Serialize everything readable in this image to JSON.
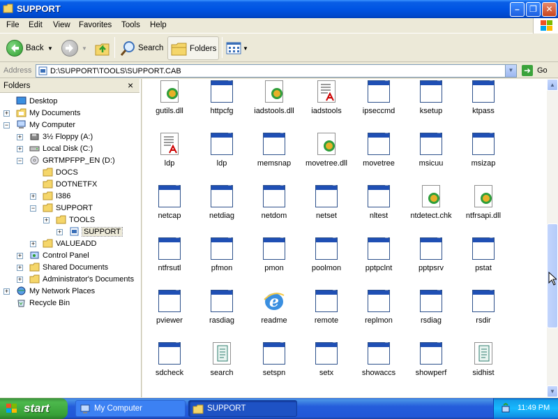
{
  "window": {
    "title": "SUPPORT"
  },
  "menu": [
    "File",
    "Edit",
    "View",
    "Favorites",
    "Tools",
    "Help"
  ],
  "toolbar": {
    "back": "Back",
    "search": "Search",
    "folders": "Folders"
  },
  "address": {
    "label": "Address",
    "path": "D:\\SUPPORT\\TOOLS\\SUPPORT.CAB",
    "go": "Go"
  },
  "folders_pane": {
    "header": "Folders",
    "close": "×",
    "tree": [
      {
        "label": "Desktop"
      },
      {
        "label": "My Documents",
        "expander": "+"
      },
      {
        "label": "My Computer",
        "expander": "−"
      },
      {
        "label": "3½ Floppy (A:)",
        "expander": "+"
      },
      {
        "label": "Local Disk (C:)",
        "expander": "+"
      },
      {
        "label": "GRTMPFPP_EN (D:)",
        "expander": "−"
      },
      {
        "label": "DOCS"
      },
      {
        "label": "DOTNETFX"
      },
      {
        "label": "I386",
        "expander": "+"
      },
      {
        "label": "SUPPORT",
        "expander": "−"
      },
      {
        "label": "TOOLS",
        "expander": "+"
      },
      {
        "label": "SUPPORT",
        "expander": "+",
        "selected": true
      },
      {
        "label": "VALUEADD",
        "expander": "+"
      },
      {
        "label": "Control Panel",
        "expander": "+"
      },
      {
        "label": "Shared Documents",
        "expander": "+"
      },
      {
        "label": "Administrator's Documents",
        "expander": "+"
      },
      {
        "label": "My Network Places",
        "expander": "+"
      },
      {
        "label": "Recycle Bin"
      }
    ]
  },
  "files": [
    [
      {
        "name": "gutils.dll",
        "icon": "dll-icon"
      },
      {
        "name": "httpcfg",
        "icon": "app-icon"
      },
      {
        "name": "iadstools.dll",
        "icon": "dll-icon"
      },
      {
        "name": "iadstools",
        "icon": "document-icon"
      },
      {
        "name": "ipseccmd",
        "icon": "app-icon"
      },
      {
        "name": "ksetup",
        "icon": "app-icon"
      },
      {
        "name": "ktpass",
        "icon": "app-icon"
      }
    ],
    [
      {
        "name": "ldp",
        "icon": "document-icon"
      },
      {
        "name": "ldp",
        "icon": "app-icon"
      },
      {
        "name": "memsnap",
        "icon": "app-icon"
      },
      {
        "name": "movetree.dll",
        "icon": "dll-icon"
      },
      {
        "name": "movetree",
        "icon": "app-icon"
      },
      {
        "name": "msicuu",
        "icon": "app-icon"
      },
      {
        "name": "msizap",
        "icon": "app-icon"
      }
    ],
    [
      {
        "name": "netcap",
        "icon": "app-icon"
      },
      {
        "name": "netdiag",
        "icon": "app-icon"
      },
      {
        "name": "netdom",
        "icon": "app-icon"
      },
      {
        "name": "netset",
        "icon": "app-icon"
      },
      {
        "name": "nltest",
        "icon": "app-icon"
      },
      {
        "name": "ntdetect.chk",
        "icon": "dll-icon"
      },
      {
        "name": "ntfrsapi.dll",
        "icon": "dll-icon"
      }
    ],
    [
      {
        "name": "ntfrsutl",
        "icon": "app-icon"
      },
      {
        "name": "pfmon",
        "icon": "app-icon"
      },
      {
        "name": "pmon",
        "icon": "app-icon"
      },
      {
        "name": "poolmon",
        "icon": "app-icon"
      },
      {
        "name": "pptpclnt",
        "icon": "app-icon"
      },
      {
        "name": "pptpsrv",
        "icon": "app-icon"
      },
      {
        "name": "pstat",
        "icon": "app-icon"
      }
    ],
    [
      {
        "name": "pviewer",
        "icon": "app-icon"
      },
      {
        "name": "rasdiag",
        "icon": "app-icon"
      },
      {
        "name": "readme",
        "icon": "ie-icon"
      },
      {
        "name": "remote",
        "icon": "app-icon"
      },
      {
        "name": "replmon",
        "icon": "app-icon"
      },
      {
        "name": "rsdiag",
        "icon": "app-icon"
      },
      {
        "name": "rsdir",
        "icon": "app-icon"
      }
    ],
    [
      {
        "name": "sdcheck",
        "icon": "app-icon"
      },
      {
        "name": "search",
        "icon": "script-icon"
      },
      {
        "name": "setspn",
        "icon": "app-icon"
      },
      {
        "name": "setx",
        "icon": "app-icon"
      },
      {
        "name": "showaccs",
        "icon": "app-icon"
      },
      {
        "name": "showperf",
        "icon": "app-icon"
      },
      {
        "name": "sidhist",
        "icon": "script-icon"
      }
    ]
  ],
  "taskbar": {
    "start": "start",
    "tasks": [
      "My Computer",
      "SUPPORT"
    ],
    "clock": "11:49 PM"
  }
}
